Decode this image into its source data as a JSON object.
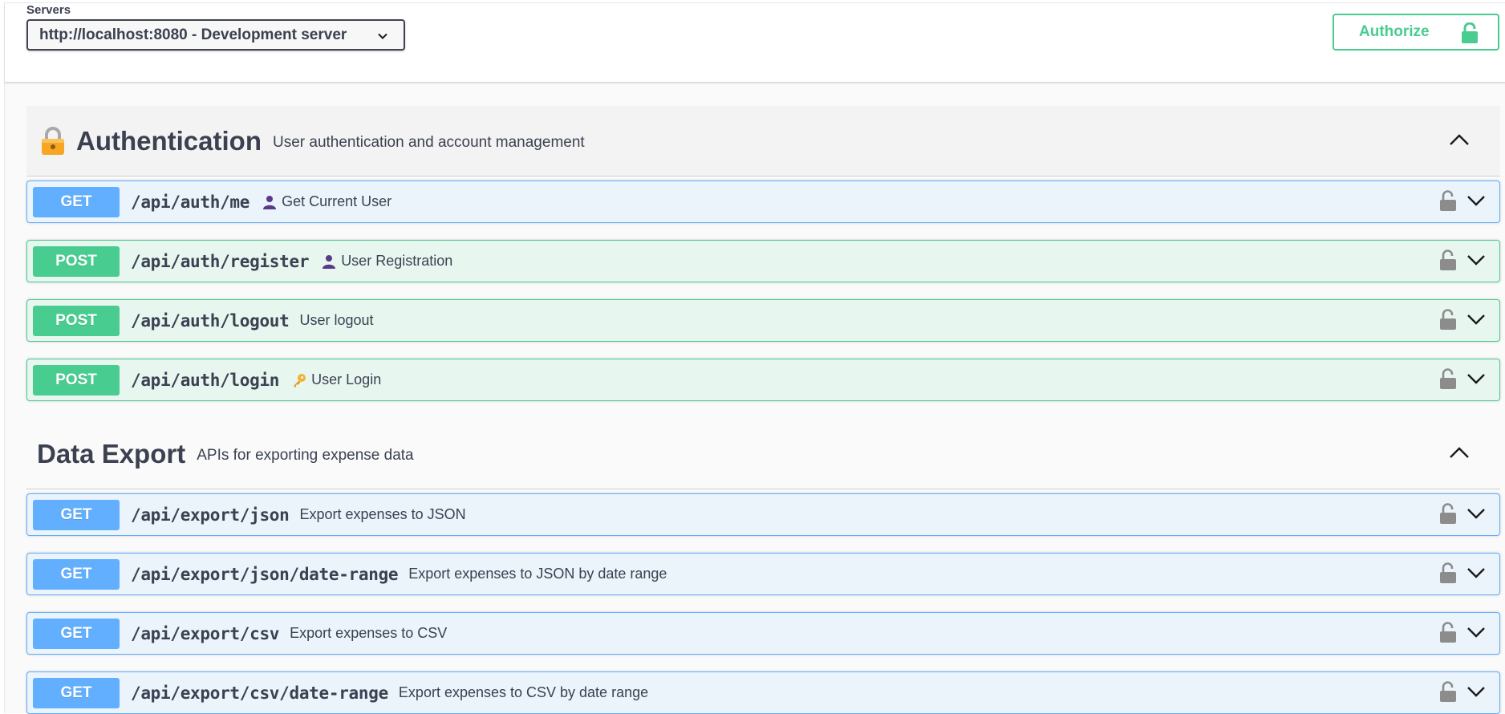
{
  "servers": {
    "label": "Servers",
    "selected": "http://localhost:8080 - Development server"
  },
  "authorize": {
    "label": "Authorize"
  },
  "colors": {
    "get": "#61affe",
    "post": "#49cc90",
    "text": "#3b4151"
  },
  "tags": [
    {
      "icon": "lock-emoji-icon",
      "name": "Authentication",
      "description": "User authentication and account management",
      "operations": [
        {
          "method": "GET",
          "path": "/api/auth/me",
          "icon": "user-icon",
          "summary": "Get Current User"
        },
        {
          "method": "POST",
          "path": "/api/auth/register",
          "icon": "user-icon",
          "summary": "User Registration"
        },
        {
          "method": "POST",
          "path": "/api/auth/logout",
          "icon": "",
          "summary": "User logout"
        },
        {
          "method": "POST",
          "path": "/api/auth/login",
          "icon": "key-icon",
          "summary": "User Login"
        }
      ]
    },
    {
      "icon": "",
      "name": "Data Export",
      "description": "APIs for exporting expense data",
      "operations": [
        {
          "method": "GET",
          "path": "/api/export/json",
          "summary": "Export expenses to JSON"
        },
        {
          "method": "GET",
          "path": "/api/export/json/date-range",
          "summary": "Export expenses to JSON by date range"
        },
        {
          "method": "GET",
          "path": "/api/export/csv",
          "summary": "Export expenses to CSV"
        },
        {
          "method": "GET",
          "path": "/api/export/csv/date-range",
          "summary": "Export expenses to CSV by date range"
        }
      ]
    }
  ]
}
